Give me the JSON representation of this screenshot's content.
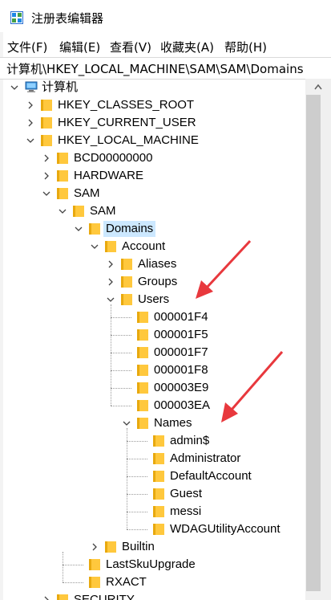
{
  "window": {
    "title": "注册表编辑器"
  },
  "menu": [
    {
      "label": "文件(F)"
    },
    {
      "label": "编辑(E)"
    },
    {
      "label": "查看(V)"
    },
    {
      "label": "收藏夹(A)"
    },
    {
      "label": "帮助(H)"
    }
  ],
  "address": {
    "path": "计算机\\HKEY_LOCAL_MACHINE\\SAM\\SAM\\Domains"
  },
  "tree": [
    {
      "label": "计算机",
      "depth": 0,
      "state": "expanded",
      "icon": "computer-icon"
    },
    {
      "label": "HKEY_CLASSES_ROOT",
      "depth": 1,
      "state": "collapsed",
      "icon": "folder-icon"
    },
    {
      "label": "HKEY_CURRENT_USER",
      "depth": 1,
      "state": "collapsed",
      "icon": "folder-icon"
    },
    {
      "label": "HKEY_LOCAL_MACHINE",
      "depth": 1,
      "state": "expanded",
      "icon": "folder-icon"
    },
    {
      "label": "BCD00000000",
      "depth": 2,
      "state": "collapsed",
      "icon": "folder-icon"
    },
    {
      "label": "HARDWARE",
      "depth": 2,
      "state": "collapsed",
      "icon": "folder-icon"
    },
    {
      "label": "SAM",
      "depth": 2,
      "state": "expanded",
      "icon": "folder-icon"
    },
    {
      "label": "SAM",
      "depth": 3,
      "state": "expanded",
      "icon": "folder-icon"
    },
    {
      "label": "Domains",
      "depth": 4,
      "state": "expanded",
      "icon": "folder-icon",
      "selected": true
    },
    {
      "label": "Account",
      "depth": 5,
      "state": "expanded",
      "icon": "folder-icon"
    },
    {
      "label": "Aliases",
      "depth": 6,
      "state": "collapsed",
      "icon": "folder-icon"
    },
    {
      "label": "Groups",
      "depth": 6,
      "state": "collapsed",
      "icon": "folder-icon"
    },
    {
      "label": "Users",
      "depth": 6,
      "state": "expanded",
      "icon": "folder-icon"
    },
    {
      "label": "000001F4",
      "depth": 7,
      "state": "leaf",
      "icon": "folder-icon"
    },
    {
      "label": "000001F5",
      "depth": 7,
      "state": "leaf",
      "icon": "folder-icon"
    },
    {
      "label": "000001F7",
      "depth": 7,
      "state": "leaf",
      "icon": "folder-icon"
    },
    {
      "label": "000001F8",
      "depth": 7,
      "state": "leaf",
      "icon": "folder-icon"
    },
    {
      "label": "000003E9",
      "depth": 7,
      "state": "leaf",
      "icon": "folder-icon"
    },
    {
      "label": "000003EA",
      "depth": 7,
      "state": "leaf",
      "icon": "folder-icon"
    },
    {
      "label": "Names",
      "depth": 7,
      "state": "expanded",
      "icon": "folder-icon"
    },
    {
      "label": "admin$",
      "depth": 8,
      "state": "leaf",
      "icon": "folder-icon"
    },
    {
      "label": "Administrator",
      "depth": 8,
      "state": "leaf",
      "icon": "folder-icon"
    },
    {
      "label": "DefaultAccount",
      "depth": 8,
      "state": "leaf",
      "icon": "folder-icon"
    },
    {
      "label": "Guest",
      "depth": 8,
      "state": "leaf",
      "icon": "folder-icon"
    },
    {
      "label": "messi",
      "depth": 8,
      "state": "leaf",
      "icon": "folder-icon"
    },
    {
      "label": "WDAGUtilityAccount",
      "depth": 8,
      "state": "leaf",
      "icon": "folder-icon"
    },
    {
      "label": "Builtin",
      "depth": 5,
      "state": "collapsed",
      "icon": "folder-icon"
    },
    {
      "label": "LastSkuUpgrade",
      "depth": 4,
      "state": "leaf",
      "icon": "folder-icon"
    },
    {
      "label": "RXACT",
      "depth": 4,
      "state": "leaf",
      "icon": "folder-icon"
    },
    {
      "label": "SECURITY",
      "depth": 2,
      "state": "collapsed",
      "icon": "folder-icon"
    }
  ],
  "colors": {
    "selection": "#cce8ff",
    "folder": "#ffc83d",
    "annotation_arrow": "#e8383d",
    "scrollbar_thumb": "#cdcdcd"
  }
}
